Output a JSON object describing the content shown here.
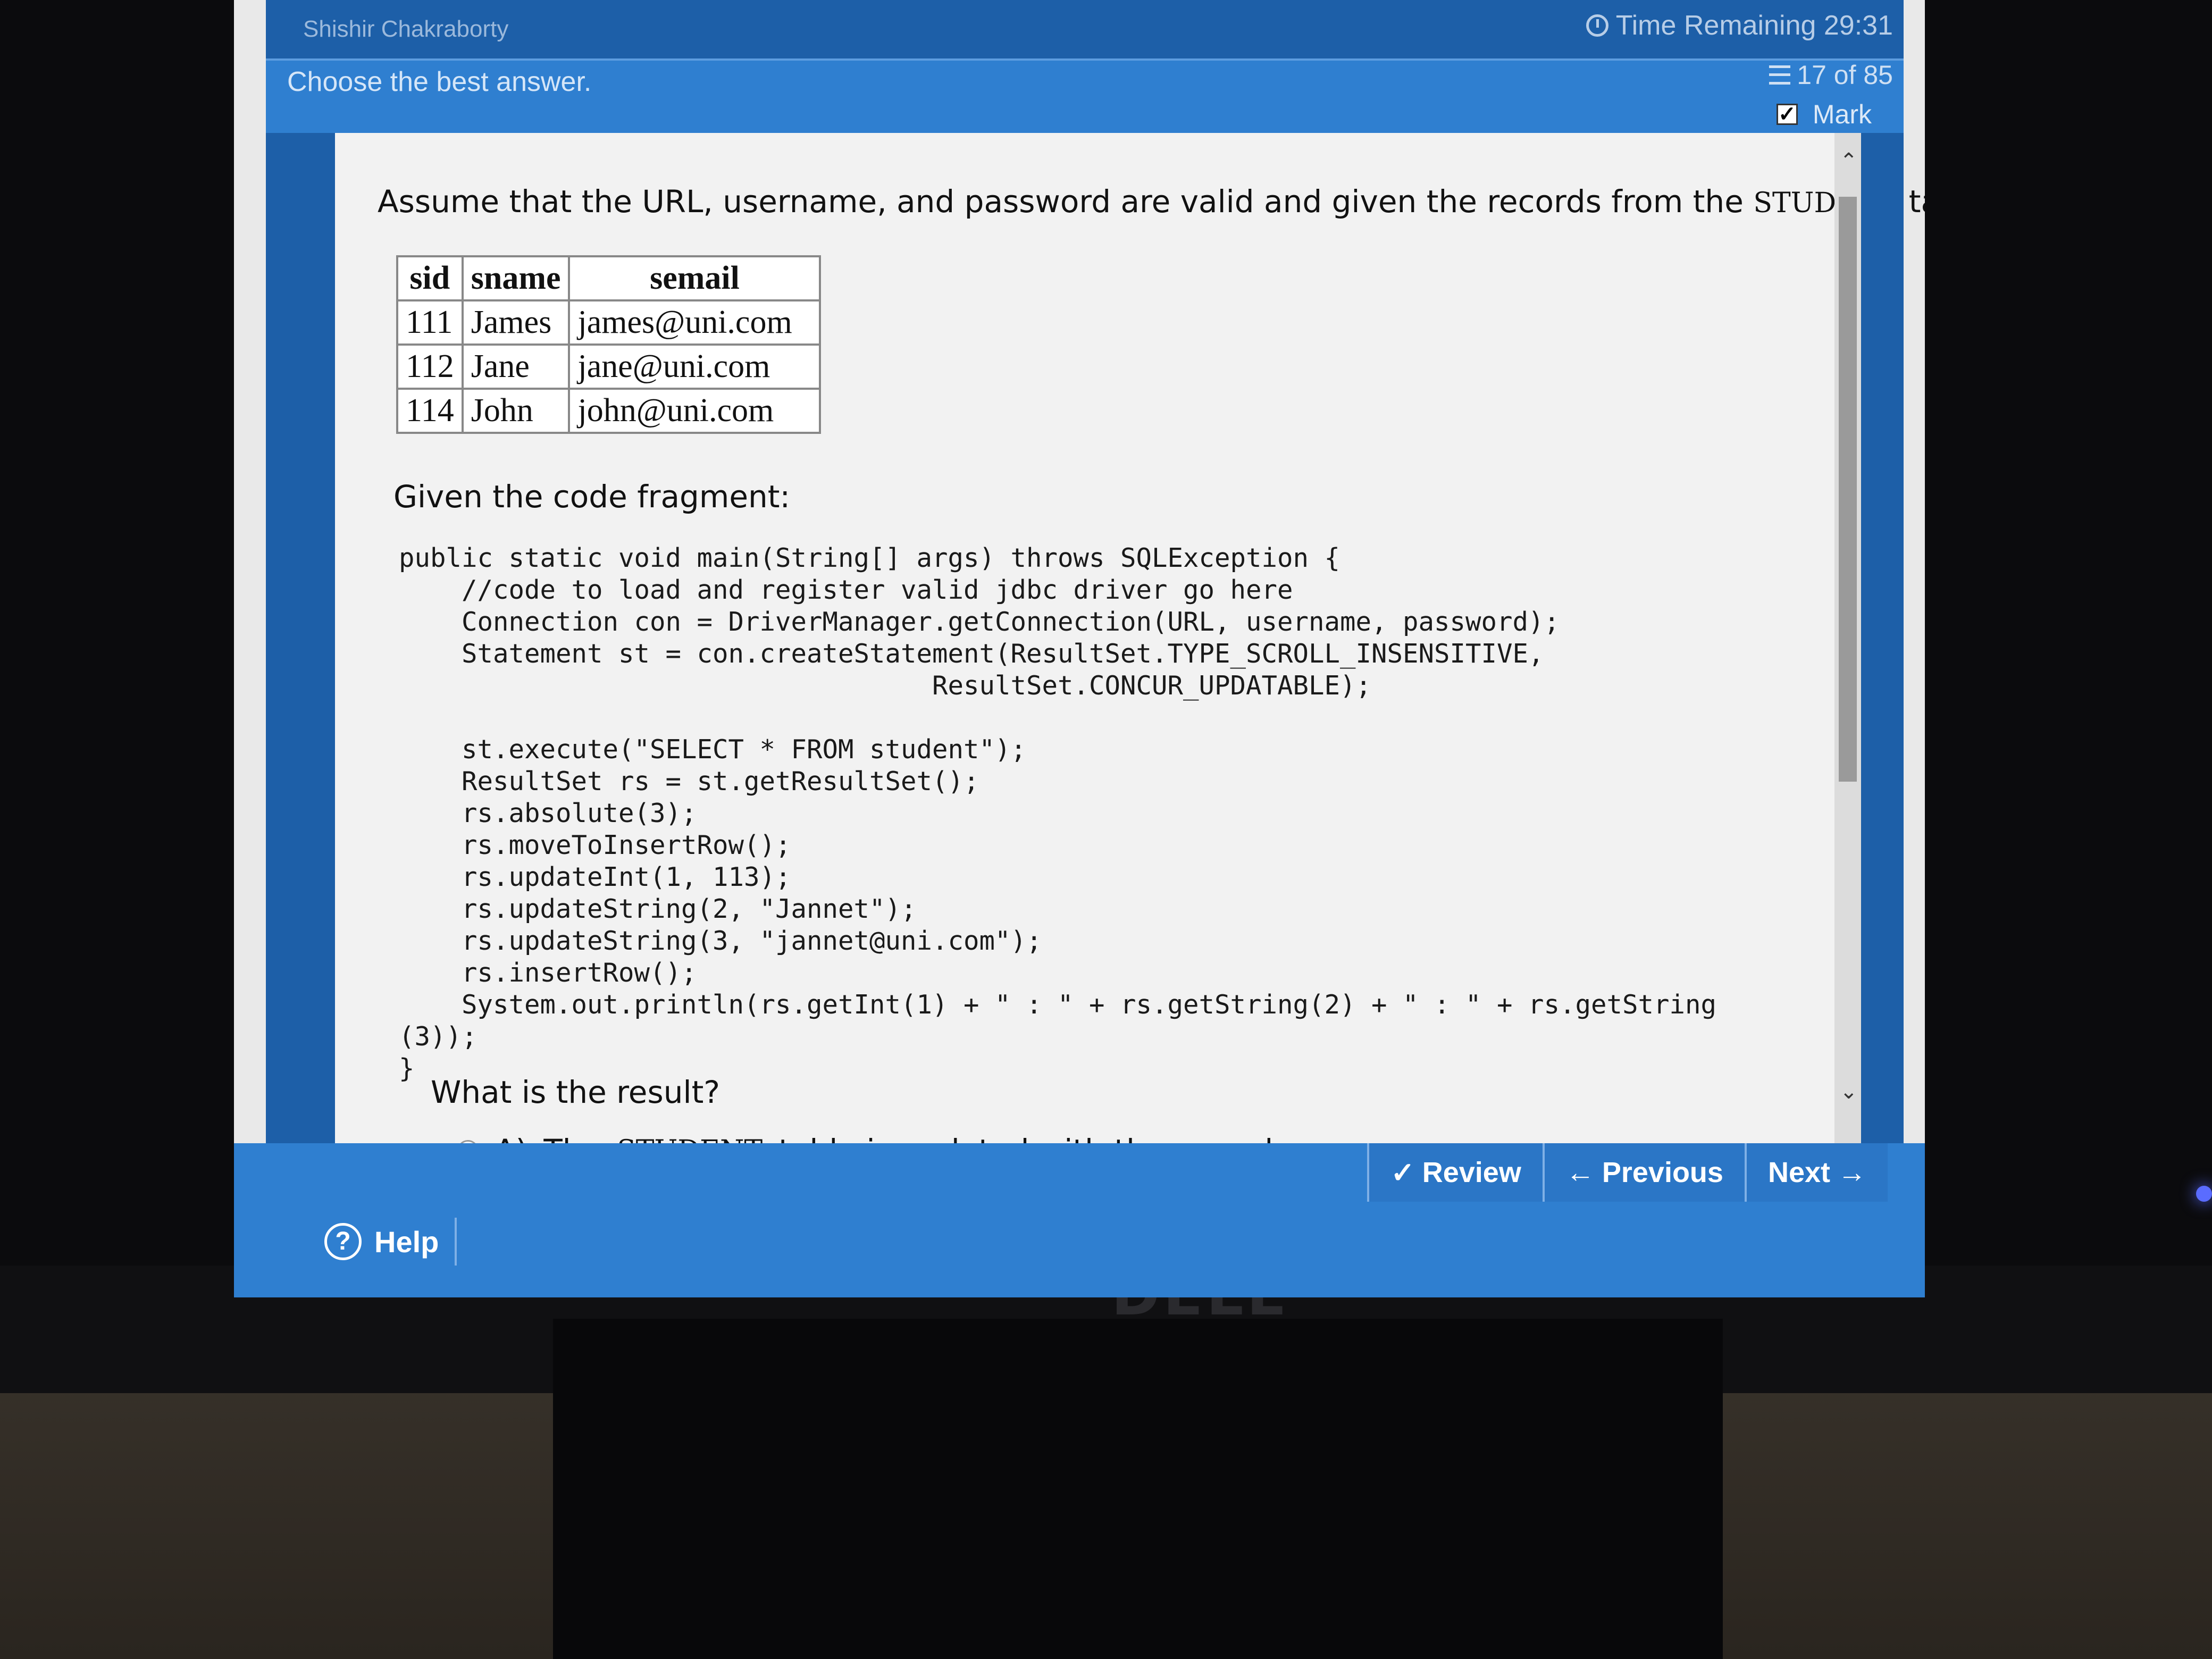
{
  "header": {
    "student_name": "Shishir Chakraborty",
    "time_remaining": "Time Remaining 29:31"
  },
  "instruction_bar": {
    "instruction": "Choose the best answer.",
    "progress": "17 of 85",
    "mark_label": "Mark",
    "mark_checked": true
  },
  "question": {
    "intro_before": "Assume that the URL, username, and password are valid and given the records from the",
    "table_name": "STUDENT",
    "intro_after": "table:",
    "table": {
      "headers": [
        "sid",
        "sname",
        "semail"
      ],
      "rows": [
        [
          "111",
          "James",
          "james@uni.com"
        ],
        [
          "112",
          "Jane",
          "jane@uni.com"
        ],
        [
          "114",
          "John",
          "john@uni.com"
        ]
      ]
    },
    "given_label": "Given the code fragment:",
    "code_lines": [
      "public static void main(String[] args) throws SQLException {",
      "    //code to load and register valid jdbc driver go here",
      "    Connection con = DriverManager.getConnection(URL, username, password);",
      "    Statement st = con.createStatement(ResultSet.TYPE_SCROLL_INSENSITIVE,",
      "                                  ResultSet.CONCUR_UPDATABLE);",
      "",
      "    st.execute(\"SELECT * FROM student\");",
      "    ResultSet rs = st.getResultSet();",
      "    rs.absolute(3);",
      "    rs.moveToInsertRow();",
      "    rs.updateInt(1, 113);",
      "    rs.updateString(2, \"Jannet\");",
      "    rs.updateString(3, \"jannet@uni.com\");",
      "    rs.insertRow();",
      "    System.out.println(rs.getInt(1) + \" : \" + rs.getString(2) + \" : \" + rs.getString",
      "(3));",
      "}"
    ],
    "prompt": "What is the result?",
    "options": [
      {
        "label": "A)",
        "text_before": "The",
        "table_name": "STUDENT",
        "text_after": "table is updated with the record:"
      }
    ]
  },
  "footer": {
    "review_label": "Review",
    "previous_label": "Previous",
    "next_label": "Next",
    "help_label": "Help"
  },
  "monitor": {
    "brand": "DELL"
  },
  "colors": {
    "header_blue": "#1d5fa8",
    "bar_blue": "#2f7fd0",
    "content_bg": "#f2f2f2"
  }
}
